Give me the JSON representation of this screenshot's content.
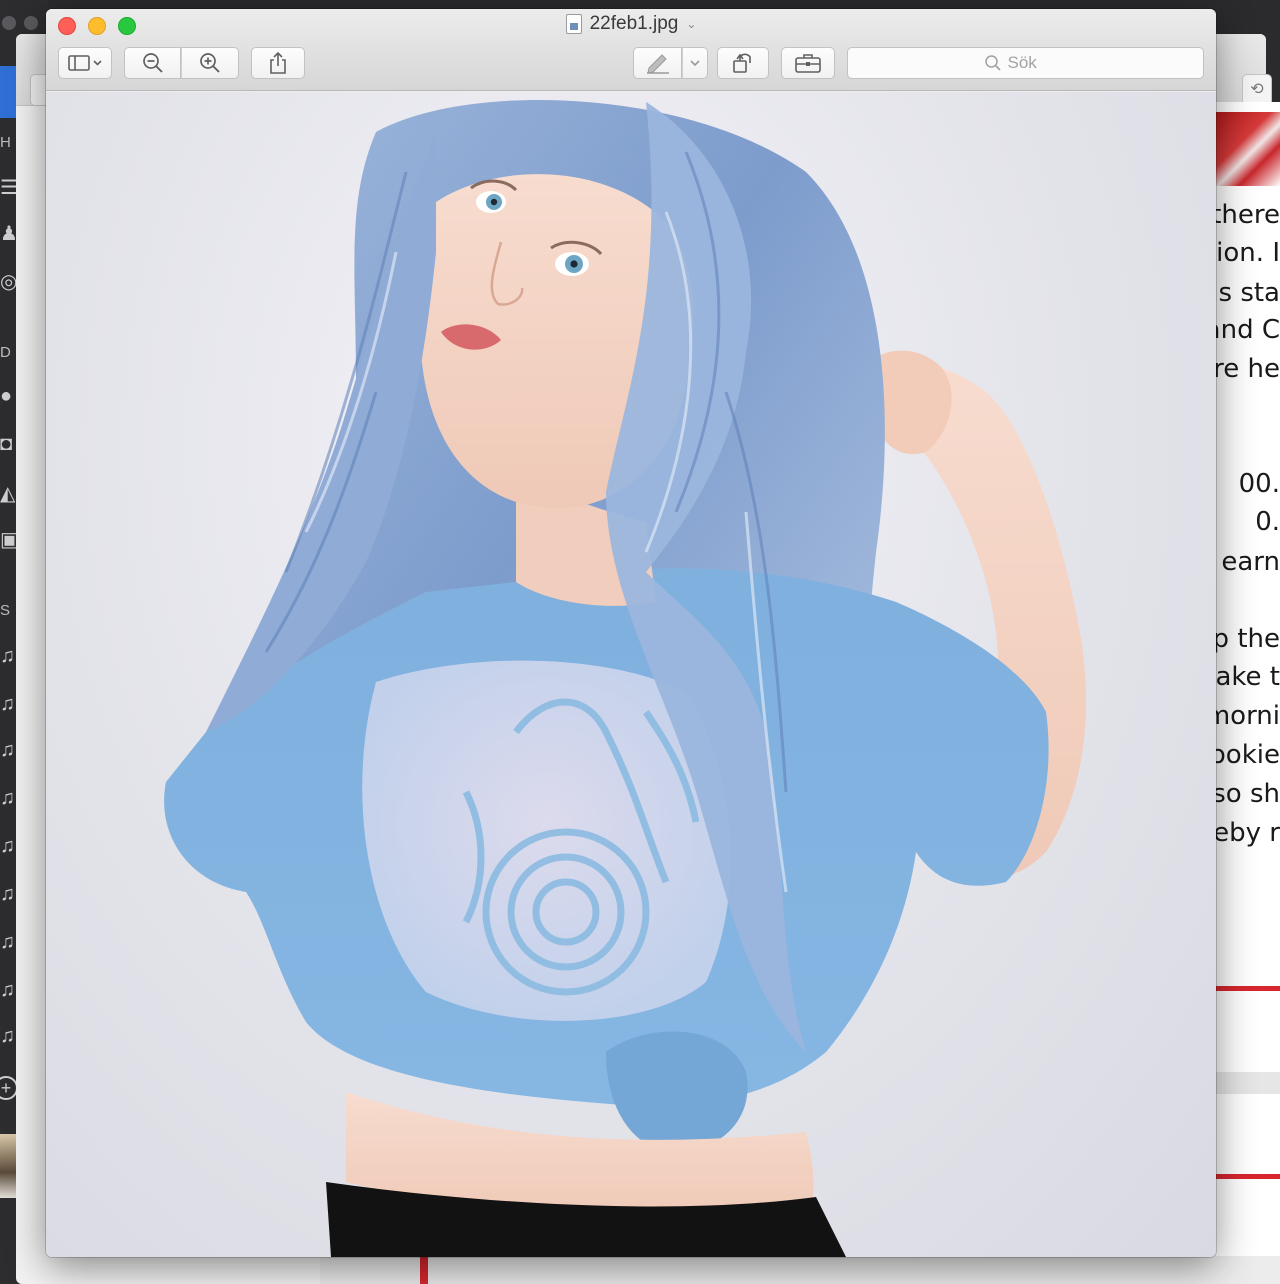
{
  "viewer": {
    "file_name": "22feb1.jpg",
    "search_placeholder": "Sök",
    "icons": {
      "sidebar": "sidebar-toggle-icon",
      "zoom_out": "zoom-out-icon",
      "zoom_in": "zoom-in-icon",
      "share": "share-icon",
      "markup": "markup-pen-icon",
      "rotate": "rotate-left-icon",
      "toolbox": "toolbox-icon",
      "search": "search-icon"
    },
    "colors": {
      "close": "#ff5f57",
      "minimize": "#ffbd2e",
      "maximize": "#28c940"
    }
  },
  "background_left": {
    "letters": [
      "H",
      "D",
      "S"
    ]
  },
  "background_web": {
    "text_lines": [
      "there",
      "tion. I",
      "is sta",
      "and C",
      "re he",
      "00.",
      "0.",
      "earn",
      "ep the",
      "ake t",
      "morni",
      "cookie",
      "lso sh",
      "eby r"
    ]
  }
}
